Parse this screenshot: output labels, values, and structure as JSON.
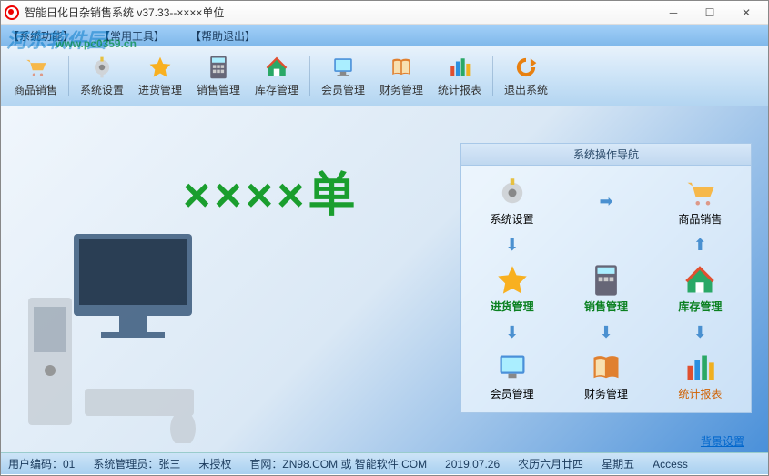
{
  "window": {
    "title": "智能日化日杂销售系统 v37.33--××××单位"
  },
  "menu": {
    "system": "【系统功能】",
    "common": "【常用工具】",
    "help": "【帮助退出】"
  },
  "watermark": {
    "name": "河东软件园",
    "url": "www.pc0359.cn"
  },
  "toolbar": {
    "sales": "商品销售",
    "settings": "系统设置",
    "purchase": "进货管理",
    "sell": "销售管理",
    "stock": "库存管理",
    "member": "会员管理",
    "finance": "财务管理",
    "report": "统计报表",
    "exit": "退出系统"
  },
  "brand": "××××单",
  "nav": {
    "title": "系统操作导航",
    "settings": "系统设置",
    "sales": "商品销售",
    "purchase": "进货管理",
    "sell": "销售管理",
    "stock": "库存管理",
    "member": "会员管理",
    "finance": "财务管理",
    "report": "统计报表"
  },
  "bg_link": "背景设置",
  "status": {
    "usercode": "用户编码：01",
    "admin": "系统管理员：张三",
    "auth": "未授权",
    "site": "官网：ZN98.COM 或 智能软件.COM",
    "date": "2019.07.26",
    "lunar": "农历六月廿四",
    "weekday": "星期五",
    "db": "Access"
  }
}
